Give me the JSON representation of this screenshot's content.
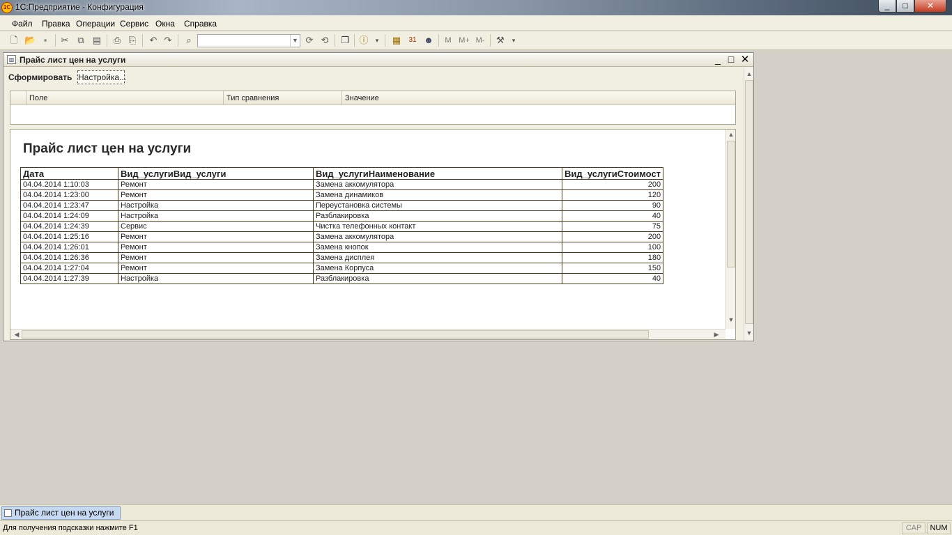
{
  "app": {
    "title": "1С:Предприятие - Конфигурация",
    "icon_text": "1C"
  },
  "window_controls": {
    "minimize": "_",
    "maximize": "□",
    "close": "✕"
  },
  "menu": [
    {
      "label": "Файл"
    },
    {
      "label": "Правка"
    },
    {
      "label": "Операции"
    },
    {
      "label": "Сервис"
    },
    {
      "label": "Окна"
    },
    {
      "label": "Справка"
    }
  ],
  "toolbar": {
    "icons": [
      "new-document-icon",
      "open-folder-icon",
      "save-icon",
      "cut-icon",
      "copy-icon",
      "paste-icon",
      "print-icon",
      "print-preview-icon",
      "undo-icon",
      "redo-icon",
      "search-icon",
      "find-next-icon",
      "find-prev-icon",
      "windows-icon",
      "info-icon",
      "calculator-icon",
      "calendar-icon",
      "users-icon",
      "memory-m-icon",
      "memory-plus-icon",
      "memory-minus-icon",
      "tools-icon"
    ],
    "search_value": "",
    "memory_labels": {
      "m": "M",
      "m_plus": "M+",
      "m_minus": "M-"
    }
  },
  "report_window": {
    "title": "Прайс лист цен на услуги",
    "form_button": "Сформировать",
    "settings_button": "Настройка...",
    "filter_columns": [
      "Поле",
      "Тип сравнения",
      "Значение"
    ],
    "report_title": "Прайс лист цен на услуги",
    "table": {
      "headers": [
        "Дата",
        "Вид_услугиВид_услуги",
        "Вид_услугиНаименование",
        "Вид_услугиСтоимост"
      ],
      "rows": [
        [
          "04.04.2014 1:10:03",
          "Ремонт",
          "Замена аккомулятора",
          "200"
        ],
        [
          "04.04.2014 1:23:00",
          "Ремонт",
          "Замена динамиков",
          "120"
        ],
        [
          "04.04.2014 1:23:47",
          "Настройка",
          "Переустановка системы",
          "90"
        ],
        [
          "04.04.2014 1:24:09",
          "Настройка",
          "Разблакировка",
          "40"
        ],
        [
          "04.04.2014 1:24:39",
          "Сервис",
          "Чистка телефонных контакт",
          "75"
        ],
        [
          "04.04.2014 1:25:16",
          "Ремонт",
          "Замена аккомулятора",
          "200"
        ],
        [
          "04.04.2014 1:26:01",
          "Ремонт",
          "Замена кнопок",
          "100"
        ],
        [
          "04.04.2014 1:26:36",
          "Ремонт",
          "Замена дисплея",
          "180"
        ],
        [
          "04.04.2014 1:27:04",
          "Ремонт",
          "Замена Корпуса",
          "150"
        ],
        [
          "04.04.2014 1:27:39",
          "Настройка",
          "Разблакировка",
          "40"
        ]
      ]
    }
  },
  "taskbar": {
    "items": [
      {
        "label": "Прайс лист цен на услуги"
      }
    ]
  },
  "statusbar": {
    "hint": "Для получения подсказки нажмите F1",
    "cap": "CAP",
    "num": "NUM"
  }
}
